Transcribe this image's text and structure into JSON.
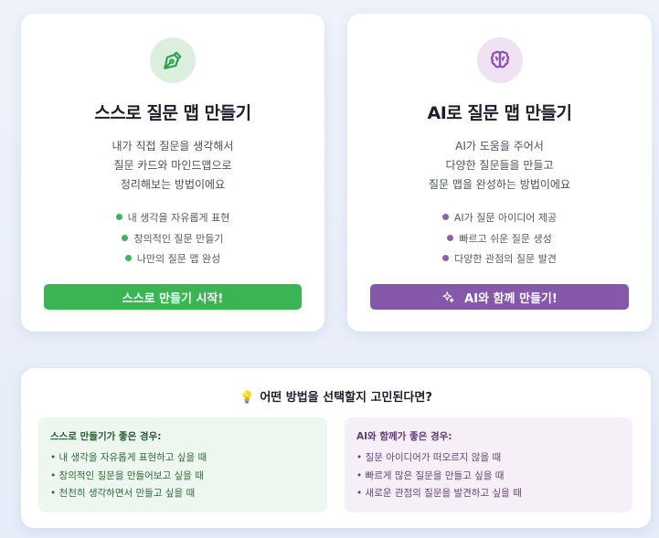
{
  "self_card": {
    "icon": "pen-nib-icon",
    "title": "스스로 질문 맵 만들기",
    "description": [
      "내가 직접 질문을 생각해서",
      "질문 카드와 마인드맵으로",
      "정리해보는 방법이에요"
    ],
    "features": [
      "내 생각을 자유롭게 표현",
      "창의적인 질문 만들기",
      "나만의 질문 맵 완성"
    ],
    "button_label": "스스로 만들기 시작!",
    "accent_color": "#3bb554"
  },
  "ai_card": {
    "icon": "brain-icon",
    "title": "AI로 질문 맵 만들기",
    "description": [
      "AI가 도움을 주어서",
      "다양한 질문들을 만들고",
      "질문 맵을 완성하는 방법이에요"
    ],
    "features": [
      "AI가 질문 아이디어 제공",
      "빠르고 쉬운 질문 생성",
      "다양한 관점의 질문 발견"
    ],
    "button_icon": "sparkles-icon",
    "button_label": "AI와 함께 만들기!",
    "accent_color": "#8558ab"
  },
  "help": {
    "icon": "lightbulb-icon",
    "title": "어떤 방법을 선택할지 고민된다면?",
    "self_box": {
      "title": "스스로 만들기가 좋은 경우:",
      "items": [
        "내 생각을 자유롭게 표현하고 싶을 때",
        "창의적인 질문을 만들어보고 싶을 때",
        "천천히 생각하면서 만들고 싶을 때"
      ]
    },
    "ai_box": {
      "title": "AI와 함께가 좋은 경우:",
      "items": [
        "질문 아이디어가 떠오르지 않을 때",
        "빠르게 많은 질문을 만들고 싶을 때",
        "새로운 관점의 질문을 발견하고 싶을 때"
      ]
    }
  }
}
